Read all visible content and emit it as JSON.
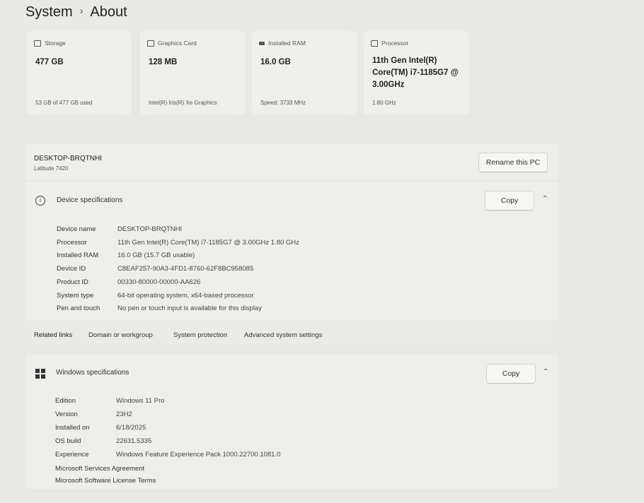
{
  "breadcrumb": {
    "parent": "System",
    "separator": "›",
    "current": "About"
  },
  "tiles": [
    {
      "icon": "storage-icon",
      "label": "Storage",
      "value": "477 GB",
      "footer": "53 GB of 477 GB used"
    },
    {
      "icon": "graphics-card-icon",
      "label": "Graphics Card",
      "value": "128 MB",
      "footer": "Intel(R) Iris(R) Xe Graphics"
    },
    {
      "icon": "ram-icon",
      "label": "Installed RAM",
      "value": "16.0 GB",
      "footer": "Speed: 3733 MHz"
    },
    {
      "icon": "processor-icon",
      "label": "Processor",
      "value": "11th Gen Intel(R) Core(TM) i7-1185G7 @ 3.00GHz",
      "footer": "1.80 GHz"
    }
  ],
  "pc": {
    "name": "DESKTOP-BRQTNHI",
    "model": "Latitude 7420",
    "rename_label": "Rename this PC"
  },
  "device_specs": {
    "title": "Device specifications",
    "copy_label": "Copy",
    "rows": [
      {
        "label": "Device name",
        "value": "DESKTOP-BRQTNHI"
      },
      {
        "label": "Processor",
        "value": "11th Gen Intel(R) Core(TM) i7-1185G7 @ 3.00GHz   1.80 GHz"
      },
      {
        "label": "Installed RAM",
        "value": "16.0 GB (15.7 GB usable)"
      },
      {
        "label": "Device ID",
        "value": "C8EAF257-90A3-4FD1-8760-62F8BC958085"
      },
      {
        "label": "Product ID",
        "value": "00330-80000-00000-AA626"
      },
      {
        "label": "System type",
        "value": "64-bit operating system, x64-based processor"
      },
      {
        "label": "Pen and touch",
        "value": "No pen or touch input is available for this display"
      }
    ]
  },
  "related_links": {
    "title": "Related links",
    "links": [
      "Domain or workgroup",
      "System protection",
      "Advanced system settings"
    ]
  },
  "windows_specs": {
    "title": "Windows specifications",
    "copy_label": "Copy",
    "rows": [
      {
        "label": "Edition",
        "value": "Windows 11 Pro"
      },
      {
        "label": "Version",
        "value": "23H2"
      },
      {
        "label": "Installed on",
        "value": "6/18/2025"
      },
      {
        "label": "OS build",
        "value": "22631.5335"
      },
      {
        "label": "Experience",
        "value": "Windows Feature Experience Pack 1000.22700.1081.0"
      }
    ],
    "links": [
      "Microsoft Services Agreement",
      "Microsoft Software License Terms"
    ]
  }
}
